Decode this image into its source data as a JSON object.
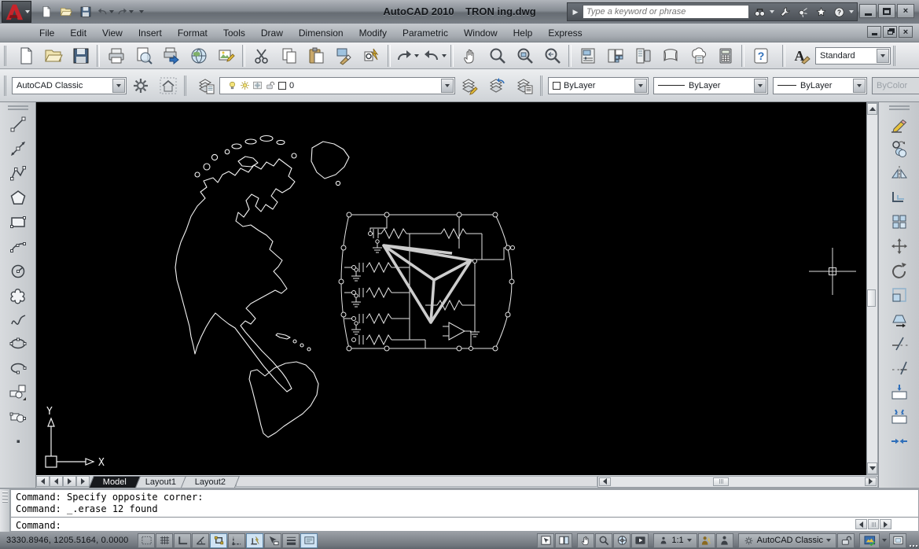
{
  "titlebar": {
    "app_title": "AutoCAD 2010",
    "doc_title": "TRON ing.dwg",
    "close_glyph": "×"
  },
  "infocenter": {
    "search_placeholder": "Type a keyword or phrase",
    "icons": [
      "expand-arrow",
      "search-binoculars",
      "customize-wrench",
      "communication-center",
      "favorites-star",
      "help"
    ]
  },
  "quick_access_icons": [
    "new",
    "open",
    "save",
    "undo",
    "redo",
    "toolbar-options"
  ],
  "menubar": {
    "items": [
      "File",
      "Edit",
      "View",
      "Insert",
      "Format",
      "Tools",
      "Draw",
      "Dimension",
      "Modify",
      "Parametric",
      "Window",
      "Help",
      "Express"
    ],
    "close_glyph": "×"
  },
  "standard_toolbar_icons": [
    "new",
    "open",
    "save",
    "plot",
    "plot-preview",
    "publish",
    "3d-dwf",
    "markup",
    "cut",
    "copy",
    "paste",
    "match-properties",
    "block-editor",
    "undo",
    "redo",
    "pan",
    "zoom-realtime",
    "zoom-window",
    "zoom-previous",
    "properties",
    "designcenter",
    "tool-palettes",
    "sheet-set-manager",
    "markup-set-manager",
    "quickcalc",
    "help"
  ],
  "styles_toolbar": {
    "text_style_glyph": "A",
    "text_style_value": "Standard"
  },
  "workspaces_toolbar": {
    "workspace_value": "AutoCAD Classic",
    "icons": [
      "workspace-settings-gear",
      "my-workspace-house"
    ]
  },
  "layers_toolbar": {
    "current_layer": "0",
    "icons": [
      "layer-properties-manager",
      "layer-on-bulb",
      "layer-freeze-sun",
      "layer-vp-freeze",
      "layer-unlock",
      "layer-color-swatch",
      "make-object-layer-current",
      "layer-previous",
      "layer-states-manager"
    ]
  },
  "properties_toolbar": {
    "color_value": "ByLayer",
    "linetype_value": "ByLayer",
    "lineweight_value": "ByLayer",
    "plot_style_value": "ByColor"
  },
  "draw_toolbar_icons": [
    "line",
    "construction-line",
    "polyline",
    "polygon",
    "rectangle",
    "arc",
    "circle",
    "revision-cloud",
    "spline",
    "ellipse",
    "ellipse-arc",
    "insert-block",
    "make-block",
    "point"
  ],
  "modify_toolbar_icons": [
    "erase",
    "copy",
    "mirror",
    "offset",
    "array",
    "move",
    "rotate",
    "scale",
    "stretch",
    "trim",
    "extend",
    "break-at-point",
    "break",
    "join"
  ],
  "canvas": {
    "ucs_x_label": "X",
    "ucs_y_label": "Y",
    "entities": [
      "americas-map-outline",
      "circuit-schematic",
      "tron-triangle-logo",
      "crosshair-cursor",
      "ucs-icon"
    ]
  },
  "layout_tabs": [
    "Model",
    "Layout1",
    "Layout2"
  ],
  "command_window": {
    "history_line_1": "Command: Specify opposite corner:",
    "history_line_2": "Command: _.erase 12 found",
    "prompt": "Command:"
  },
  "status_bar": {
    "coordinates": "3330.8946, 1205.5164, 0.0000",
    "toggles": [
      {
        "name": "snap",
        "on": false
      },
      {
        "name": "grid",
        "on": false
      },
      {
        "name": "ortho",
        "on": false
      },
      {
        "name": "polar",
        "on": false
      },
      {
        "name": "osnap",
        "on": true
      },
      {
        "name": "otrack",
        "on": false
      },
      {
        "name": "ducs",
        "on": true
      },
      {
        "name": "dyn",
        "on": false
      },
      {
        "name": "lwt",
        "on": false
      },
      {
        "name": "qp",
        "on": true
      }
    ],
    "annotation_scale_label": "1:1",
    "workspace_label": "AutoCAD Classic",
    "right_icons": [
      "model",
      "quick-view-layouts",
      "pan",
      "zoom",
      "steering-wheels",
      "show-motion",
      "annotation-scale",
      "annotation-visibility",
      "auto-scale",
      "workspace-gear",
      "toolbar-lock",
      "status-tray",
      "tray-menu-arrow",
      "clean-screen"
    ]
  }
}
